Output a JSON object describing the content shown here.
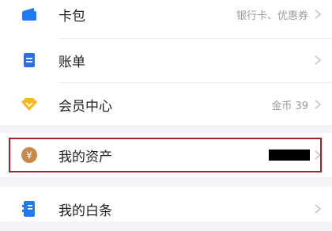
{
  "menu": {
    "items": [
      {
        "label": "卡包",
        "detail": "银行卡、优惠券",
        "icon": "card-wallet-icon",
        "color": "#1e7cf0"
      },
      {
        "label": "账单",
        "detail": "",
        "icon": "bill-icon",
        "color": "#2d6ee8"
      },
      {
        "label": "会员中心",
        "detail": "金币 39",
        "icon": "vip-diamond-icon",
        "color": "#f6b81f"
      },
      {
        "label": "我的资产",
        "detail": "",
        "icon": "yuan-coin-icon",
        "color": "#c58a4a"
      },
      {
        "label": "我的白条",
        "detail": "",
        "icon": "iou-note-icon",
        "color": "#1e7cf0"
      }
    ]
  },
  "colors": {
    "highlight_border": "#a3222a",
    "background": "#f4f4f6",
    "row_background": "#ffffff"
  }
}
